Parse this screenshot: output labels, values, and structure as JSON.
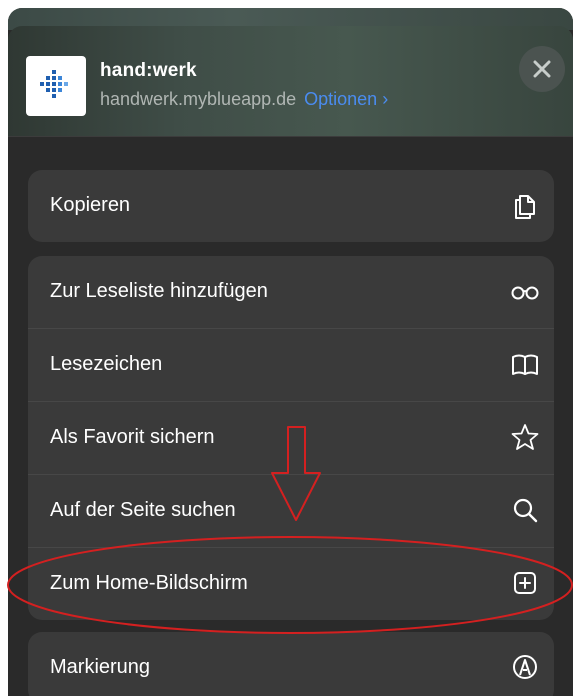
{
  "header": {
    "app_name": "hand:werk",
    "app_url": "handwerk.myblueapp.de",
    "options_label": "Optionen ›"
  },
  "groups": [
    {
      "items": [
        {
          "label": "Kopieren",
          "icon": "copy-icon"
        }
      ]
    },
    {
      "items": [
        {
          "label": "Zur Leseliste hinzufügen",
          "icon": "reading-glasses-icon"
        },
        {
          "label": "Lesezeichen",
          "icon": "book-icon"
        },
        {
          "label": "Als Favorit sichern",
          "icon": "star-icon"
        },
        {
          "label": "Auf der Seite suchen",
          "icon": "search-icon"
        },
        {
          "label": "Zum Home-Bildschirm",
          "icon": "add-square-icon"
        }
      ]
    },
    {
      "items": [
        {
          "label": "Markierung",
          "icon": "markup-icon"
        }
      ]
    }
  ],
  "colors": {
    "sheet_bg": "#2a2a2a",
    "row_bg": "#3a3a3a",
    "link": "#4a8cf0",
    "annotation": "#d42020"
  }
}
